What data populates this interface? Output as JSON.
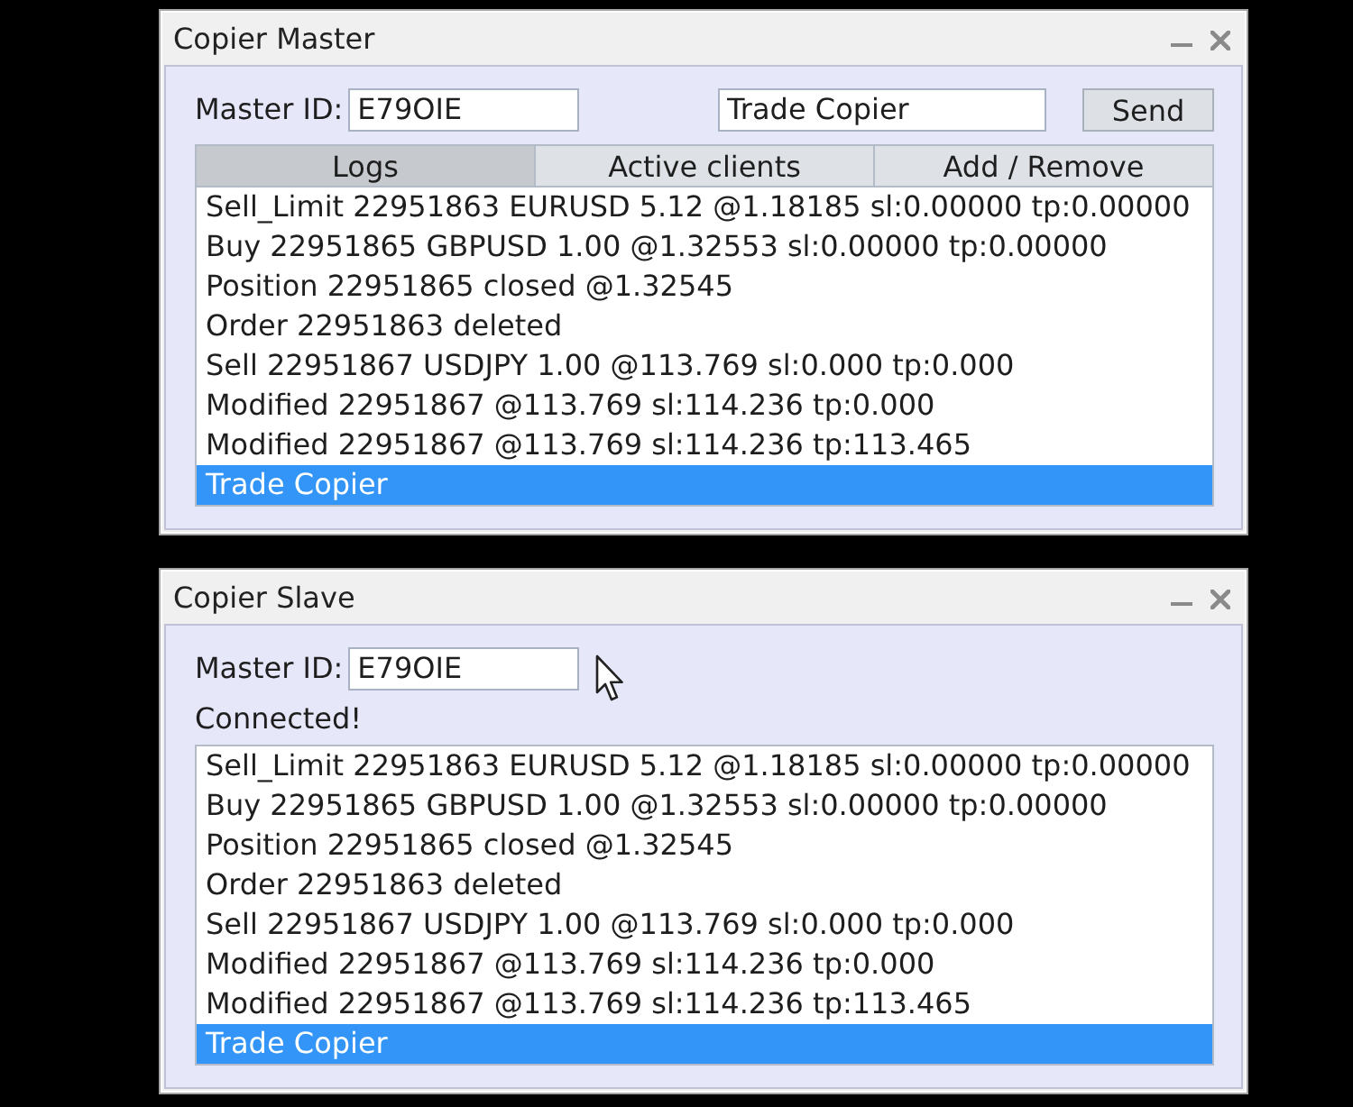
{
  "windows": [
    {
      "title": "Copier Master",
      "pointer_visible": false,
      "master_id": {
        "label": "Master ID:",
        "value": "E79OIE"
      },
      "message": {
        "value": "Trade Copier"
      },
      "send_button": "Send",
      "tabs": [
        {
          "label": "Logs",
          "selected": true
        },
        {
          "label": "Active clients",
          "selected": false
        },
        {
          "label": "Add / Remove",
          "selected": false
        }
      ],
      "log": [
        {
          "text": "Sell_Limit 22951863 EURUSD 5.12 @1.18185 sl:0.00000 tp:0.00000",
          "selected": false
        },
        {
          "text": "Buy 22951865 GBPUSD 1.00 @1.32553 sl:0.00000 tp:0.00000",
          "selected": false
        },
        {
          "text": "Position 22951865 closed @1.32545",
          "selected": false
        },
        {
          "text": "Order 22951863 deleted",
          "selected": false
        },
        {
          "text": "Sell 22951867 USDJPY 1.00 @113.769 sl:0.000 tp:0.000",
          "selected": false
        },
        {
          "text": "Modified 22951867 @113.769 sl:114.236 tp:0.000",
          "selected": false
        },
        {
          "text": "Modified 22951867 @113.769 sl:114.236 tp:113.465",
          "selected": false
        },
        {
          "text": "Trade Copier",
          "selected": true
        }
      ]
    },
    {
      "title": "Copier Slave",
      "pointer_visible": true,
      "master_id": {
        "label": "Master ID:",
        "value": "E79OIE"
      },
      "status": "Connected!",
      "log": [
        {
          "text": "Sell_Limit 22951863 EURUSD 5.12 @1.18185 sl:0.00000 tp:0.00000",
          "selected": false
        },
        {
          "text": "Buy 22951865 GBPUSD 1.00 @1.32553 sl:0.00000 tp:0.00000",
          "selected": false
        },
        {
          "text": "Position 22951865 closed @1.32545",
          "selected": false
        },
        {
          "text": "Order 22951863 deleted",
          "selected": false
        },
        {
          "text": "Sell 22951867 USDJPY 1.00 @113.769 sl:0.000 tp:0.000",
          "selected": false
        },
        {
          "text": "Modified 22951867 @113.769 sl:114.236 tp:0.000",
          "selected": false
        },
        {
          "text": "Modified 22951867 @113.769 sl:114.236 tp:113.465",
          "selected": false
        },
        {
          "text": "Trade Copier",
          "selected": true
        }
      ]
    }
  ]
}
